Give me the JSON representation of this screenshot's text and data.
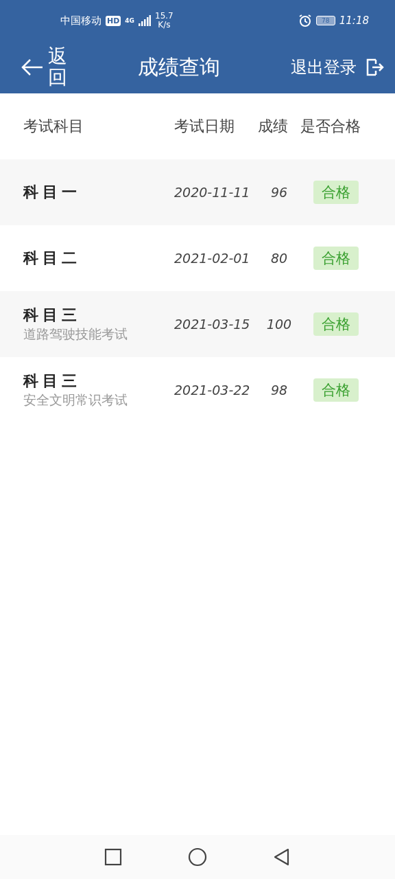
{
  "status_bar": {
    "carrier": "中国移动",
    "hd": "HD",
    "network": "4G",
    "speed": "15.7",
    "speed_unit": "K/s",
    "battery": "78",
    "time": "11:18"
  },
  "header": {
    "back": "返回",
    "title": "成绩查询",
    "logout": "退出登录"
  },
  "table": {
    "columns": [
      "考试科目",
      "考试日期",
      "成绩",
      "是否合格"
    ],
    "rows": [
      {
        "subject": "科目一",
        "date": "2020-11-11",
        "score": "96",
        "result": "合格",
        "passed": true
      },
      {
        "subject": "科目二",
        "date": "2021-02-01",
        "score": "80",
        "result": "合格",
        "passed": true
      },
      {
        "subject": "科目三",
        "detail": "道路驾驶技能考试",
        "date": "2021-03-15",
        "score": "100",
        "result": "合格",
        "passed": true
      },
      {
        "subject": "科目三",
        "detail": "安全文明常识考试",
        "date": "2021-03-22",
        "score": "98",
        "result": "合格",
        "passed": true
      }
    ]
  }
}
